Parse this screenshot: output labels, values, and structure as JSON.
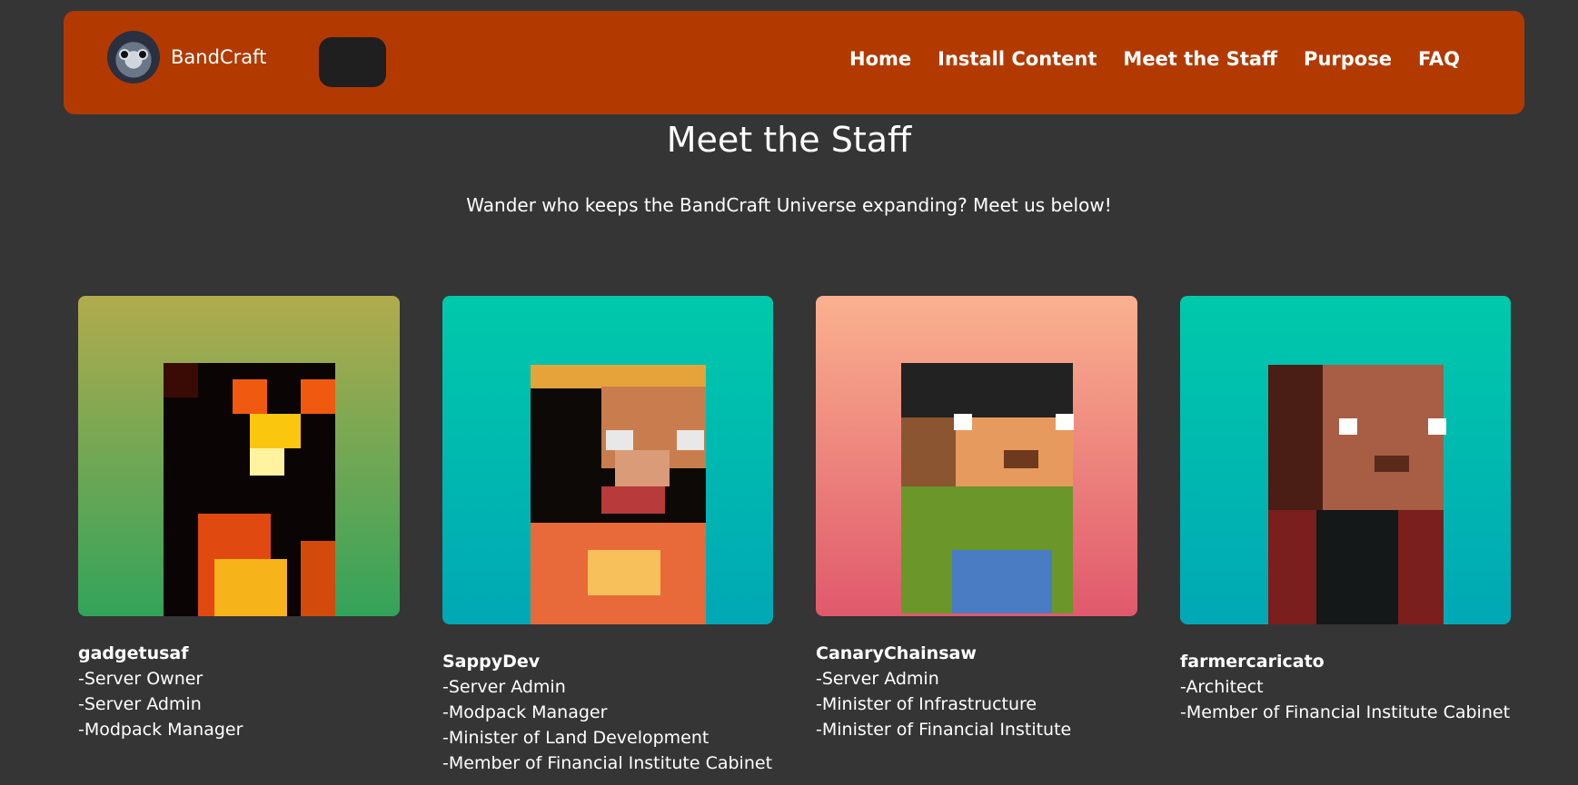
{
  "nav": {
    "brand": "BandCraft",
    "links": [
      "Home",
      "Install Content",
      "Meet the Staff",
      "Purpose",
      "FAQ"
    ]
  },
  "page": {
    "title": "Meet the Staff",
    "subtitle": "Wander who keeps the BandCraft Universe expanding? Meet us below!"
  },
  "staff": [
    {
      "name": "gadgetusaf",
      "roles": [
        "-Server Owner",
        "-Server Admin",
        "-Modpack Manager"
      ],
      "bg_top": "#b1ab4d",
      "bg_bottom": "#33a35a",
      "icon": "pixel-avatar-icon"
    },
    {
      "name": "SappyDev",
      "roles": [
        "-Server Admin",
        "-Modpack Manager",
        "-Minister of Land Development",
        "-Member of Financial Institute Cabinet"
      ],
      "bg_top": "#00c9ab",
      "bg_bottom": "#00a8b5",
      "icon": "pixel-avatar-icon"
    },
    {
      "name": "CanaryChainsaw",
      "roles": [
        "-Server Admin",
        "-Minister of Infrastructure",
        "-Minister of Financial Institute"
      ],
      "bg_top": "#fab18f",
      "bg_bottom": "#e0596c",
      "icon": "pixel-avatar-icon"
    },
    {
      "name": "farmercaricato",
      "roles": [
        "-Architect",
        "-Member of Financial Institute Cabinet"
      ],
      "bg_top": "#00c9ab",
      "bg_bottom": "#00a8b5",
      "icon": "pixel-avatar-icon"
    }
  ]
}
